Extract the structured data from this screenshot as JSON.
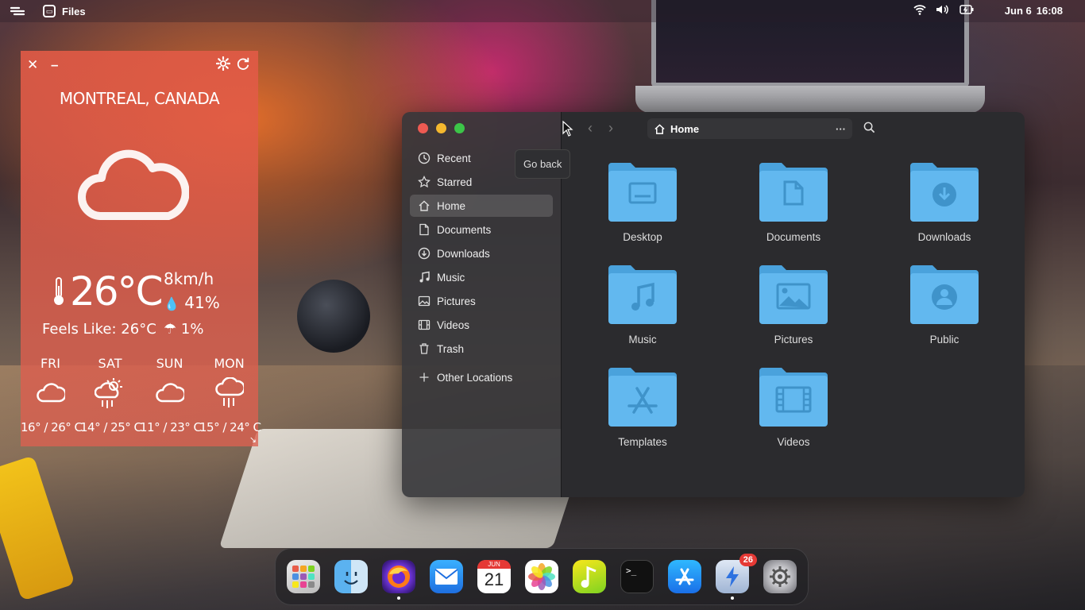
{
  "topbar": {
    "app_name": "Files",
    "date": "Jun 6",
    "time": "16:08"
  },
  "weather": {
    "city": "MONTREAL, CANADA",
    "temperature": "26°C",
    "wind": "8km/h",
    "humidity": "41%",
    "feels_like": "Feels Like: 26°C",
    "rain_chance": "1%",
    "forecast": [
      {
        "day": "FRI",
        "icon": "cloud-icon",
        "range": "16° / 26° C"
      },
      {
        "day": "SAT",
        "icon": "sun-rain-icon",
        "range": "14° / 25° C"
      },
      {
        "day": "SUN",
        "icon": "cloud-icon",
        "range": "11° / 23° C"
      },
      {
        "day": "MON",
        "icon": "rain-icon",
        "range": "15° / 24° C"
      }
    ]
  },
  "files": {
    "path": "Home",
    "tooltip": "Go back",
    "sidebar": [
      {
        "label": "Recent",
        "icon": "clock-icon"
      },
      {
        "label": "Starred",
        "icon": "star-icon"
      },
      {
        "label": "Home",
        "icon": "home-icon",
        "active": true
      },
      {
        "label": "Documents",
        "icon": "document-icon"
      },
      {
        "label": "Downloads",
        "icon": "download-icon"
      },
      {
        "label": "Music",
        "icon": "music-icon"
      },
      {
        "label": "Pictures",
        "icon": "image-icon"
      },
      {
        "label": "Videos",
        "icon": "film-icon"
      },
      {
        "label": "Trash",
        "icon": "trash-icon"
      }
    ],
    "other_locations": "Other Locations",
    "folders": [
      {
        "label": "Desktop",
        "glyph": "desktop"
      },
      {
        "label": "Documents",
        "glyph": "document"
      },
      {
        "label": "Downloads",
        "glyph": "download"
      },
      {
        "label": "Music",
        "glyph": "music"
      },
      {
        "label": "Pictures",
        "glyph": "image"
      },
      {
        "label": "Public",
        "glyph": "person"
      },
      {
        "label": "Templates",
        "glyph": "appstore"
      },
      {
        "label": "Videos",
        "glyph": "film"
      }
    ]
  },
  "dock": {
    "apps": [
      "launchpad-icon",
      "finder-icon",
      "firefox-icon",
      "mail-icon",
      "calendar-icon",
      "photos-icon",
      "music-app-icon",
      "terminal-icon",
      "app-store-icon",
      "update-icon",
      "settings-icon"
    ],
    "calendar_month": "JUN",
    "calendar_day": "21",
    "terminal_prompt": ">_",
    "badge_count": "26"
  },
  "colors": {
    "folder": "#62b8ef",
    "folder_dark": "#4aa2dc",
    "accent_red": "#ee5a52",
    "accent_yellow": "#f5b82e",
    "accent_green": "#3cc548"
  }
}
